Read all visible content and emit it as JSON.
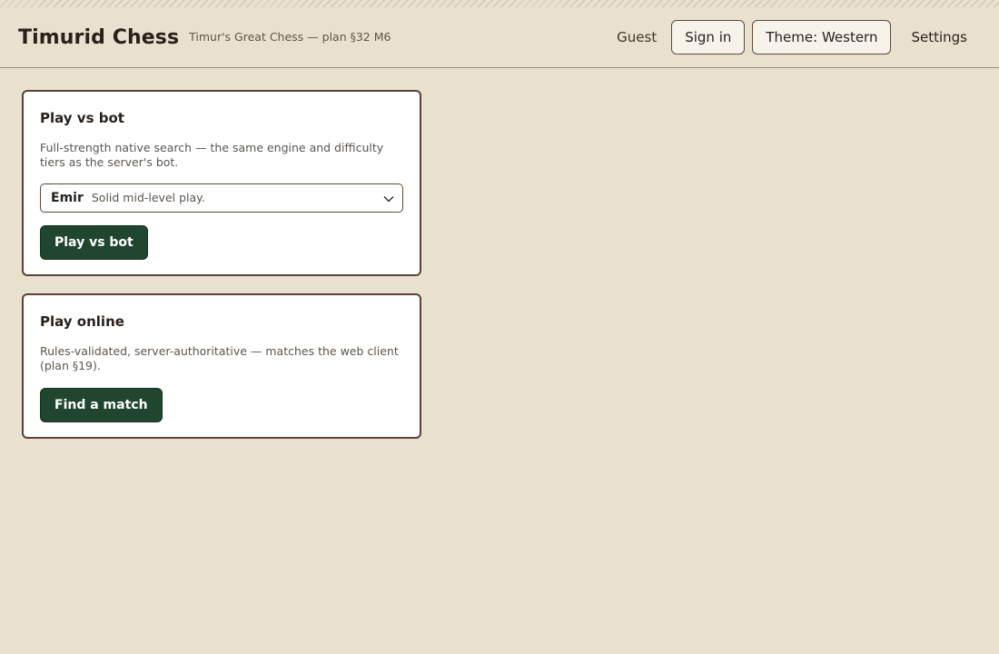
{
  "header": {
    "title": "Timurid Chess",
    "subtitle": "Timur's Great Chess — plan §32 M6",
    "user": "Guest",
    "sign_in": "Sign in",
    "theme": "Theme: Western",
    "settings": "Settings"
  },
  "bot_card": {
    "title": "Play vs bot",
    "description": "Full-strength native search — the same engine and difficulty tiers as the server's bot.",
    "difficulty": {
      "selected_name": "Emir",
      "selected_description": "Solid mid-level play."
    },
    "button": "Play vs bot"
  },
  "online_card": {
    "title": "Play online",
    "description": "Rules-validated, server-authoritative — matches the web client (plan §19).",
    "button": "Find a match"
  },
  "colors": {
    "background": "#e9e1cf",
    "primary": "#21462f",
    "border": "#5a4334"
  }
}
